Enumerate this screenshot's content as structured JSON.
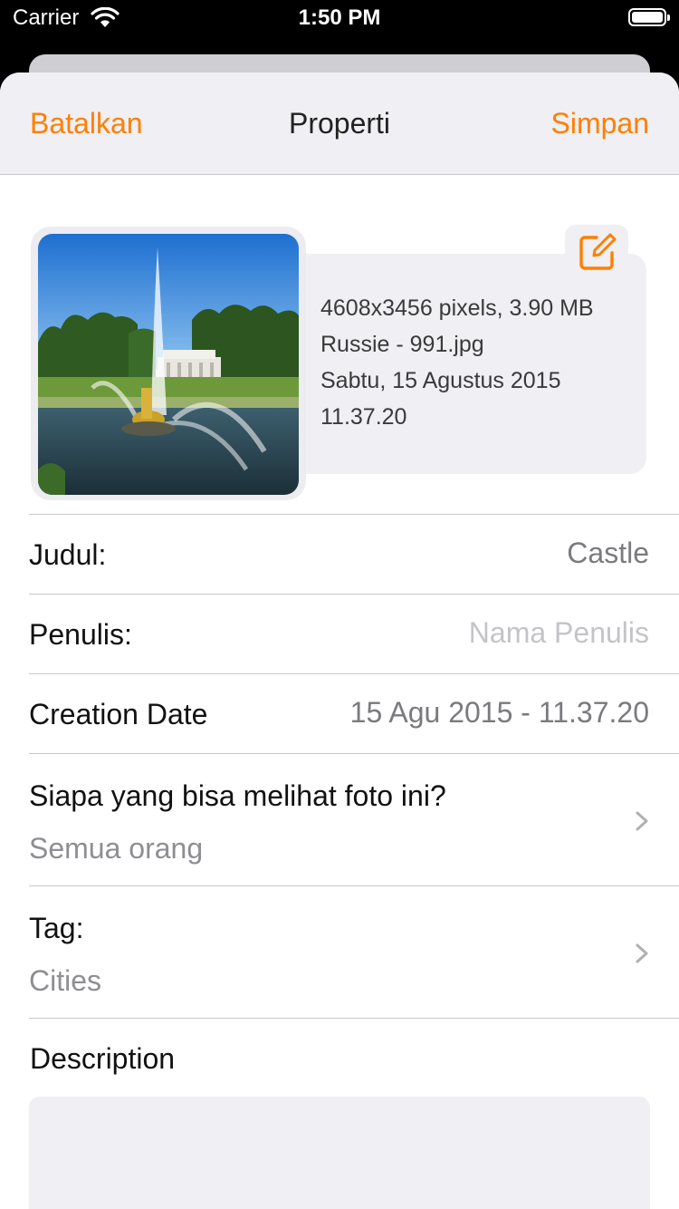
{
  "status_bar": {
    "carrier": "Carrier",
    "time": "1:50 PM"
  },
  "nav": {
    "cancel_label": "Batalkan",
    "title": "Properti",
    "save_label": "Simpan"
  },
  "photo_info": {
    "dimensions_size": "4608x3456 pixels, 3.90 MB",
    "filename": "Russie - 991.jpg",
    "date": "Sabtu, 15 Agustus 2015",
    "time": "11.37.20",
    "edit_icon": "edit-square-icon"
  },
  "fields": {
    "title": {
      "label": "Judul:",
      "value": "Castle"
    },
    "author": {
      "label": "Penulis:",
      "placeholder": "Nama Penulis"
    },
    "creation_date": {
      "label": "Creation Date",
      "value": "15 Agu 2015 - 11.37.20"
    },
    "privacy": {
      "label": "Siapa yang bisa melihat foto ini?",
      "value": "Semua orang"
    },
    "tags": {
      "label": "Tag:",
      "value": "Cities"
    },
    "description": {
      "label": "Description",
      "value": ""
    }
  },
  "colors": {
    "accent": "#ff7f00",
    "background_gray": "#efeff4",
    "separator": "#c8c8cc",
    "secondary_text": "#8e8e93",
    "placeholder_text": "#c4c4c8"
  }
}
